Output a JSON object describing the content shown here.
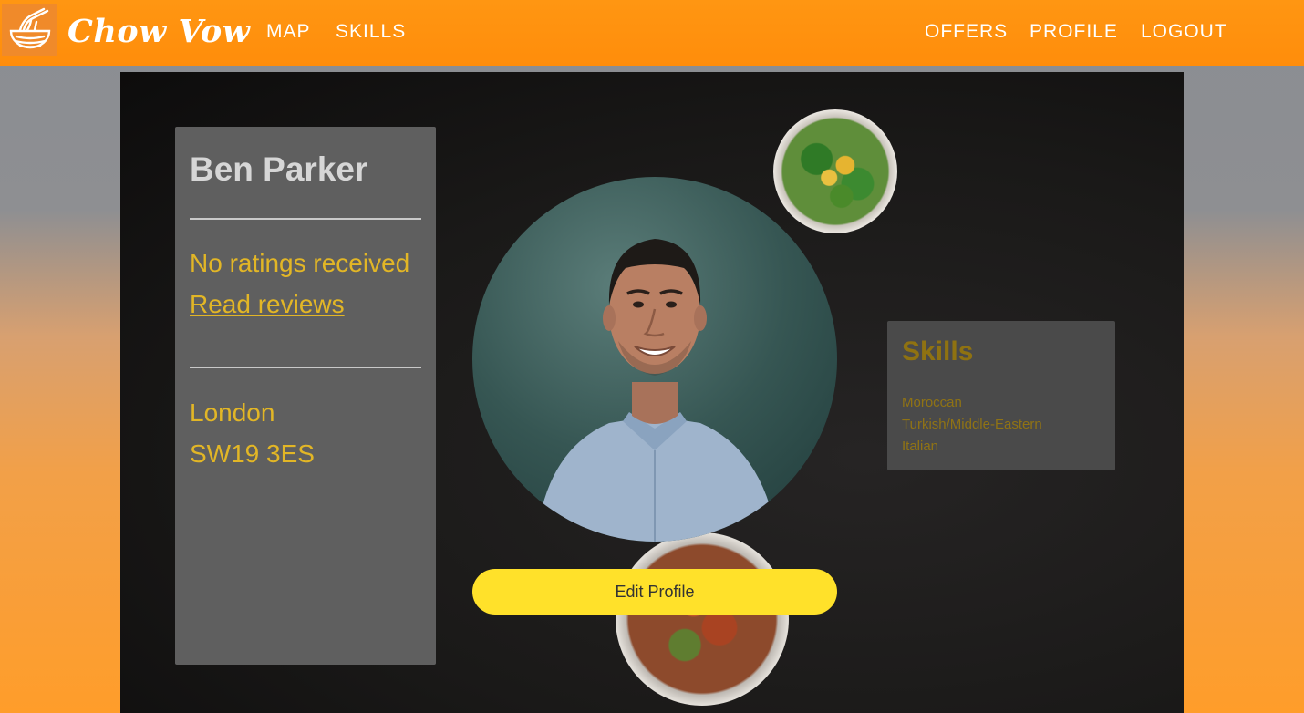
{
  "brand": {
    "name": "Chow Vow",
    "logo_icon": "noodle-bowl-icon"
  },
  "nav": {
    "left": [
      {
        "label": "MAP"
      },
      {
        "label": "SKILLS"
      }
    ],
    "right": [
      {
        "label": "OFFERS"
      },
      {
        "label": "PROFILE"
      },
      {
        "label": "LOGOUT"
      }
    ]
  },
  "profile": {
    "name": "Ben Parker",
    "ratings_text": "No ratings received",
    "reviews_link": "Read reviews",
    "city": "London",
    "postcode": "SW19 3ES",
    "photo_alt": "profile-photo"
  },
  "actions": {
    "edit_profile": "Edit Profile"
  },
  "skills": {
    "title": "Skills",
    "items": [
      "Moroccan",
      "Turkish/Middle-Eastern",
      "Italian"
    ]
  },
  "colors": {
    "nav_orange": "#ff9612",
    "accent_yellow": "#e2b626",
    "button_yellow": "#ffe12a",
    "card_grey": "#5f5f5f"
  }
}
